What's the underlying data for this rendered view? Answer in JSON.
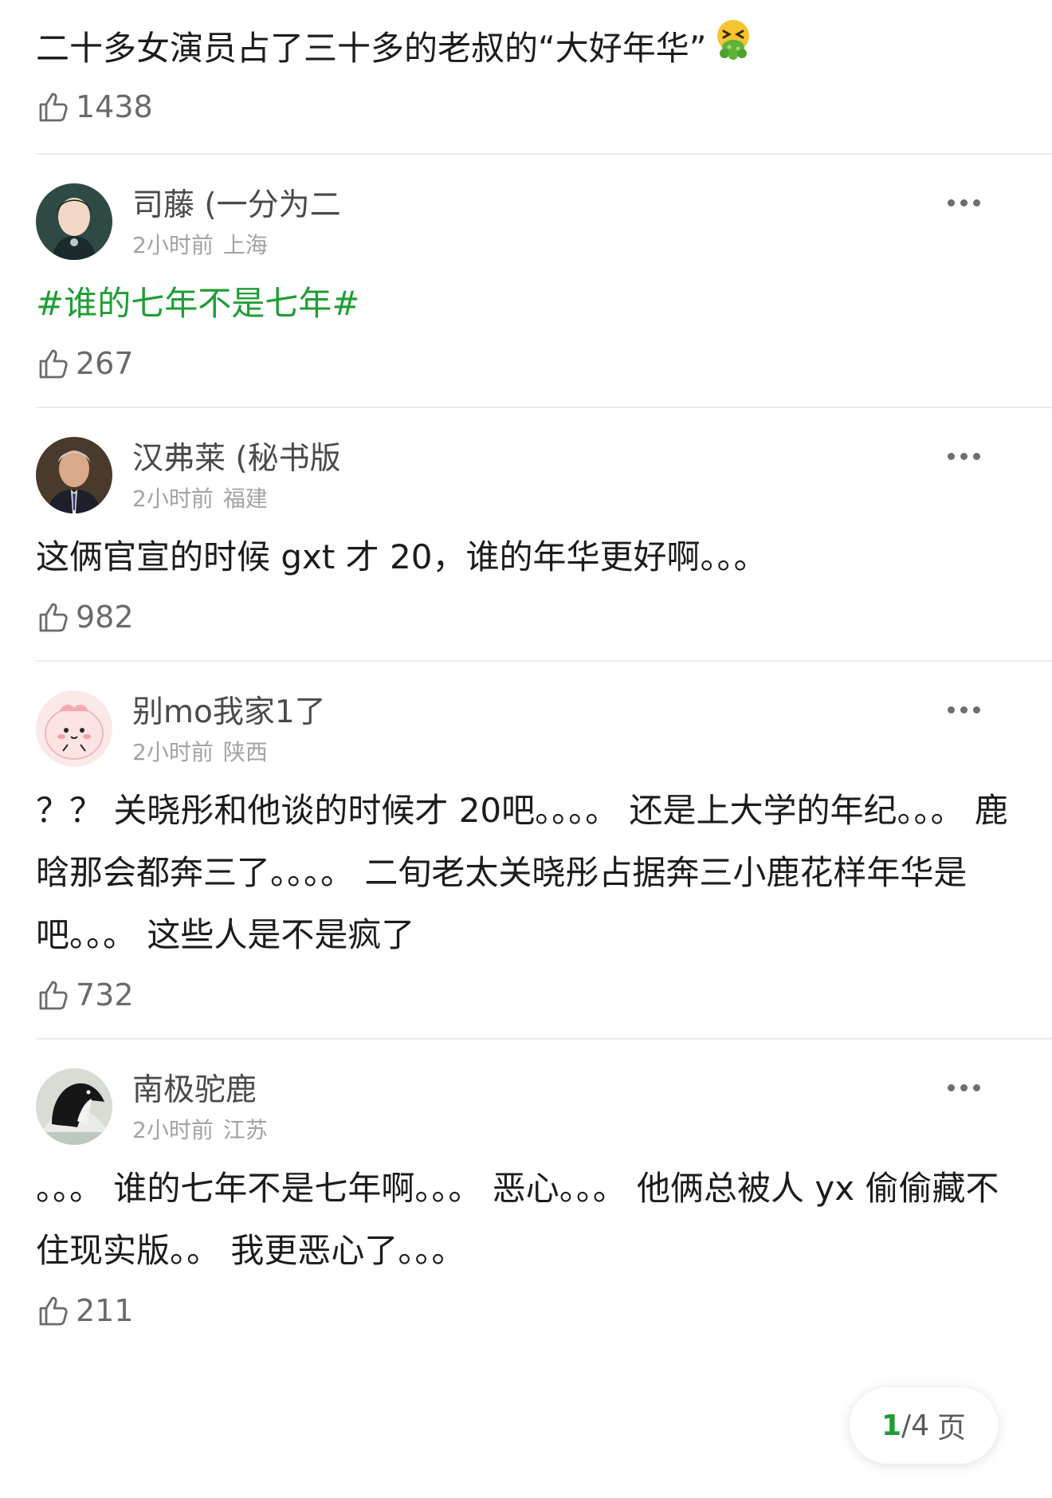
{
  "colors": {
    "topic_green": "#1f9d35",
    "meta_grey": "#a3a3a3",
    "name_grey": "#4a4a4a"
  },
  "comments": [
    {
      "text": "二十多女演员占了三十多的老叔的“大好年华”",
      "emoji": "vomiting-face-emoji",
      "likes": "1438"
    },
    {
      "name": "司藤 (一分为二",
      "time": "2小时前",
      "location": "上海",
      "text": "#谁的七年不是七年#",
      "likes": "267"
    },
    {
      "name": "汉弗莱 (秘书版",
      "time": "2小时前",
      "location": "福建",
      "text": "这俩官宣的时候 gxt 才 20，谁的年华更好啊。。。",
      "likes": "982"
    },
    {
      "name": "别mo我家1了",
      "time": "2小时前",
      "location": "陕西",
      "text": "？？ 关晓彤和他谈的时候才 20吧。。。。 还是上大学的年纪。。。 鹿晗那会都奔三了。。。。 二旬老太关晓彤占据奔三小鹿花样年华是吧。。。 这些人是不是疯了",
      "likes": "732"
    },
    {
      "name": "南极驼鹿",
      "time": "2小时前",
      "location": "江苏",
      "text": "。。。 谁的七年不是七年啊。。。 恶心。。。 他俩总被人 yx 偷偷藏不住现实版。。 我更恶心了。。。",
      "likes": "211"
    }
  ],
  "pager": {
    "current": "1",
    "total": "/4",
    "unit": "页"
  }
}
